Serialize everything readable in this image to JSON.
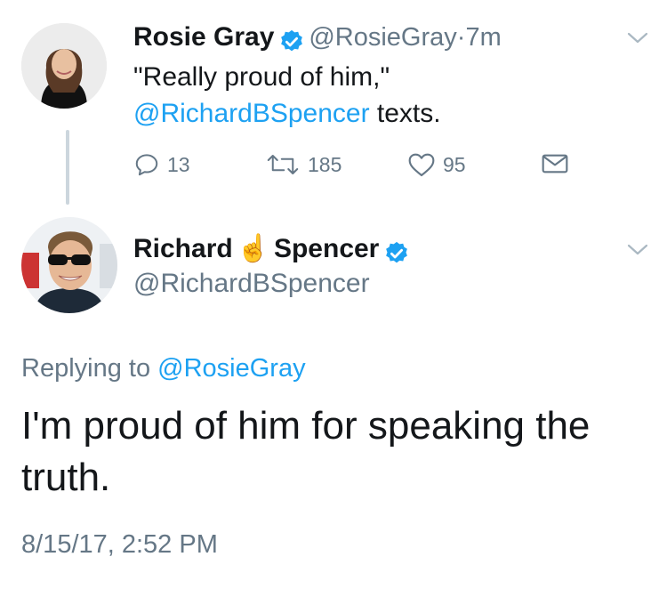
{
  "tweet": {
    "author_name": "Rosie Gray",
    "author_handle": "@RosieGray",
    "separator": "·",
    "time_ago": "7m",
    "text_prefix": "\"Really proud of him,\"",
    "text_mention": "@RichardBSpencer",
    "text_suffix": " texts.",
    "reply_count": "13",
    "retweet_count": "185",
    "like_count": "95",
    "verified": true
  },
  "reply": {
    "name_first": "Richard",
    "name_emoji": "☝️",
    "name_last": "Spencer",
    "handle": "@RichardBSpencer",
    "replying_label": "Replying to",
    "replying_to": "@RosieGray",
    "text": "I'm proud of him for speaking the truth.",
    "timestamp": "8/15/17, 2:52 PM",
    "verified": true
  },
  "colors": {
    "accent": "#1da1f2",
    "muted": "#657786",
    "text": "#14171a",
    "thread_line": "#ccd6dd"
  }
}
